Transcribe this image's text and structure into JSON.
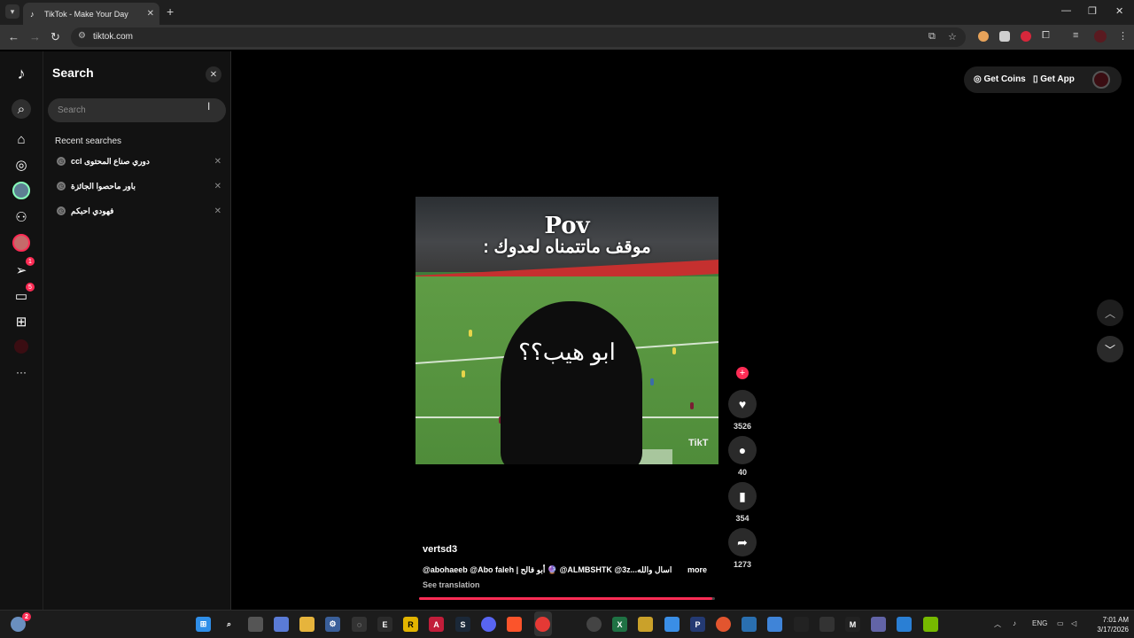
{
  "browser": {
    "tab_title": "TikTok - Make Your Day",
    "tab_close": "✕",
    "new_tab": "+",
    "url": "tiktok.com",
    "window_controls": [
      "—",
      "❐",
      "✕"
    ]
  },
  "rail": {
    "messages_badge": "5",
    "inbox_badge": "1",
    "more_label": "···"
  },
  "search_panel": {
    "title": "Search",
    "placeholder": "Search",
    "recent_label": "Recent searches",
    "recent": [
      {
        "text": "ccl دوري صناع المحتوى"
      },
      {
        "text": "باور ماحصوا الجائزة"
      },
      {
        "text": "فهودي احبكم"
      }
    ]
  },
  "header": {
    "get_coins": "Get Coins",
    "get_app": "Get App"
  },
  "video": {
    "overlay_pov": "Pov",
    "overlay_line1": "موقف ماتتمناه لعدوك :",
    "overlay_line2": "ابو هيب؟؟",
    "watermark": "TikT"
  },
  "actions": {
    "likes": "3526",
    "comments": "40",
    "saves": "354",
    "shares": "1273",
    "follow": "+"
  },
  "post": {
    "author": "vertsd3",
    "caption": "@abohaeeb @Abo faleh | أبو فالح 🔮 @ALMBSHTK @3z...اسال والله",
    "more": "more",
    "see_translation": "See translation",
    "progress": 0.99
  },
  "taskbar": {
    "weather_badge": "2",
    "lang": "ENG",
    "time": "7:01 AM",
    "date": "3/17/2026"
  }
}
